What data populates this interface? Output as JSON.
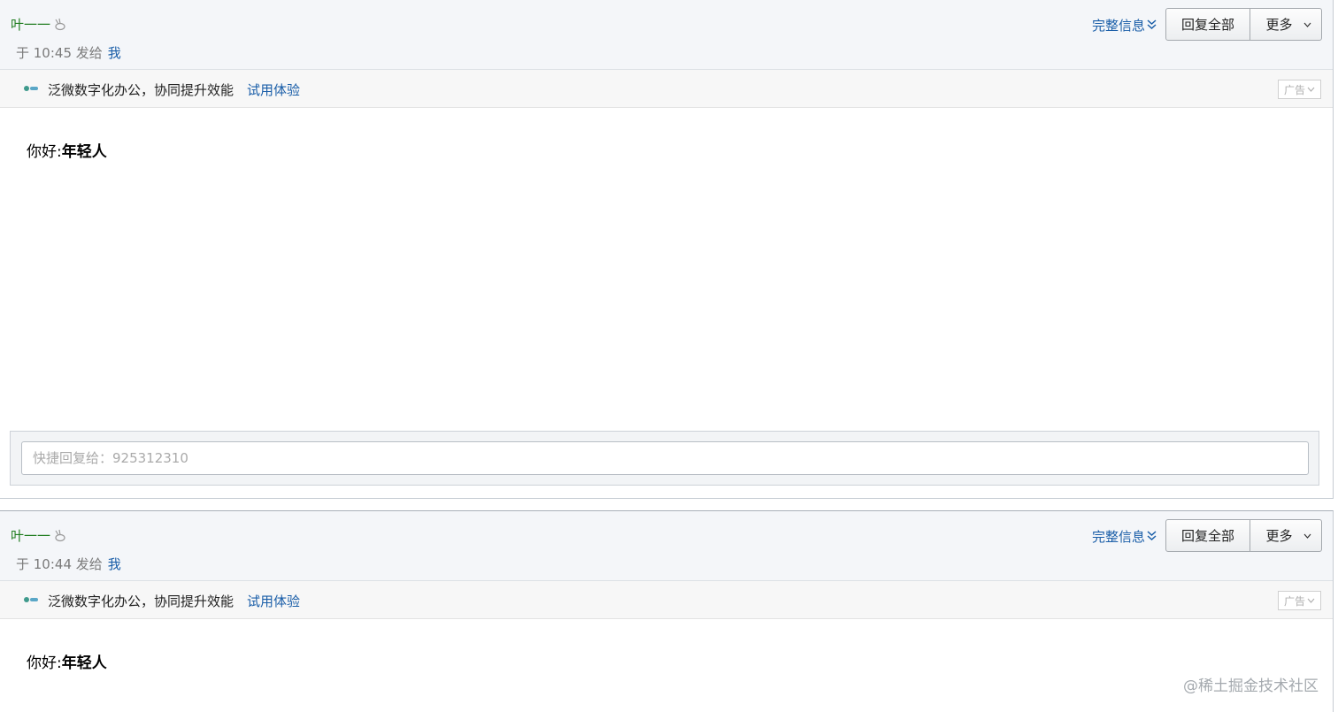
{
  "emails": [
    {
      "sender": "叶一一",
      "time_prefix": "于 10:45 发给",
      "recipient": "我",
      "full_info_label": "完整信息",
      "reply_all_label": "回复全部",
      "more_label": "更多",
      "ad_text": "泛微数字化办公，协同提升效能",
      "ad_link": "试用体验",
      "ad_tag": "广告",
      "greeting": "你好:",
      "greeting_name": "年轻人",
      "quick_reply_placeholder": "快捷回复给：925312310"
    },
    {
      "sender": "叶一一",
      "time_prefix": "于 10:44 发给",
      "recipient": "我",
      "full_info_label": "完整信息",
      "reply_all_label": "回复全部",
      "more_label": "更多",
      "ad_text": "泛微数字化办公，协同提升效能",
      "ad_link": "试用体验",
      "ad_tag": "广告",
      "greeting": "你好:",
      "greeting_name": "年轻人"
    }
  ],
  "watermark": "@稀土掘金技术社区",
  "colors": {
    "sender_green": "#1e7c1e",
    "link_blue": "#1a5ea8",
    "header_bg": "#f4f6f9",
    "ad_bg": "#f7f7f7"
  },
  "icons": [
    "rabbit-icon",
    "double-chevron-down-icon",
    "chevron-down-icon",
    "ad-logo-icon"
  ]
}
